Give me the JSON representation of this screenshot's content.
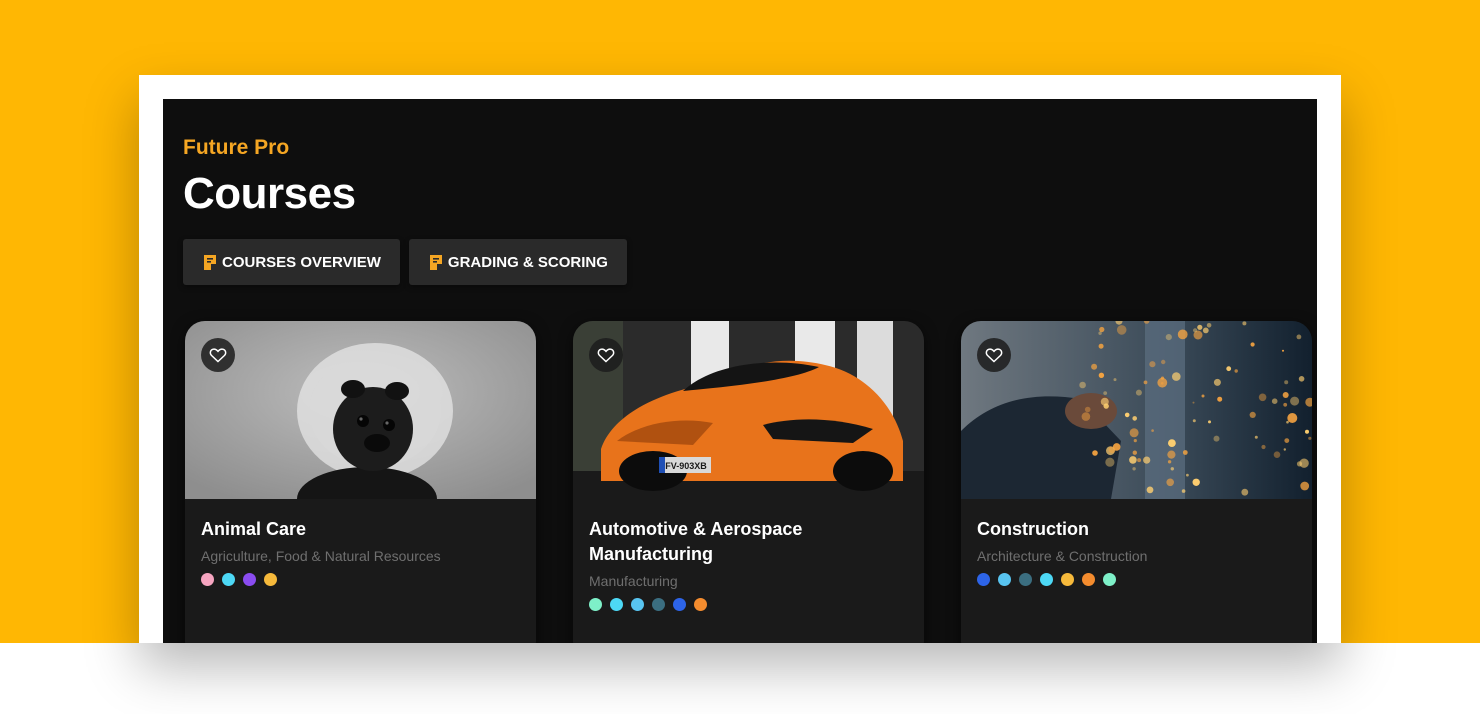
{
  "header": {
    "brand": "Future Pro",
    "title": "Courses"
  },
  "nav": [
    {
      "label": "COURSES OVERVIEW",
      "icon": "future-pro-icon"
    },
    {
      "label": "GRADING & SCORING",
      "icon": "future-pro-icon"
    }
  ],
  "colors": {
    "accent": "#f5a623",
    "background": "#0e0e0e",
    "card": "#1a1a1a",
    "page_bg": "#ffb703"
  },
  "courses": [
    {
      "title": "Animal Care",
      "category": "Agriculture, Food & Natural Resources",
      "image": "pug-in-cone-photo",
      "dots": [
        "#f6a5c0",
        "#4dd8f5",
        "#8a4cf0",
        "#f6b93b"
      ]
    },
    {
      "title": "Automotive & Aerospace Manufacturing",
      "category": "Manufacturing",
      "image": "orange-sports-car-photo",
      "plate": "FV-903XB",
      "dots": [
        "#7ef0c8",
        "#4dd8f5",
        "#58c4f0",
        "#3b6e80",
        "#2d64e8",
        "#f48c2e"
      ]
    },
    {
      "title": "Construction",
      "category": "Architecture & Construction",
      "image": "welding-sparks-photo",
      "dots": [
        "#2d64e8",
        "#58c4f0",
        "#3b6e80",
        "#4dd8f5",
        "#f6b93b",
        "#f48c2e",
        "#7ef0c8"
      ]
    }
  ]
}
